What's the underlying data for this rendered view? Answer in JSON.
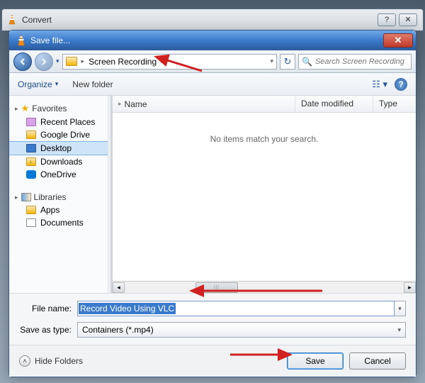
{
  "parent_window": {
    "title": "Convert"
  },
  "dialog": {
    "title": "Save file..."
  },
  "nav": {
    "folder": "Screen Recording",
    "search_placeholder": "Search Screen Recording"
  },
  "toolbar": {
    "organize": "Organize",
    "new_folder": "New folder"
  },
  "sidebar": {
    "favorites_label": "Favorites",
    "favorites": [
      {
        "label": "Recent Places"
      },
      {
        "label": "Google Drive"
      },
      {
        "label": "Desktop"
      },
      {
        "label": "Downloads"
      },
      {
        "label": "OneDrive"
      }
    ],
    "libraries_label": "Libraries",
    "libraries": [
      {
        "label": "Apps"
      },
      {
        "label": "Documents"
      }
    ]
  },
  "columns": {
    "name": "Name",
    "date": "Date modified",
    "type": "Type"
  },
  "empty_text": "No items match your search.",
  "fields": {
    "file_name_label": "File name:",
    "file_name_value": "Record Video Using VLC",
    "save_type_label": "Save as type:",
    "save_type_value": "Containers (*.mp4)"
  },
  "footer": {
    "hide_folders": "Hide Folders",
    "save": "Save",
    "cancel": "Cancel"
  }
}
